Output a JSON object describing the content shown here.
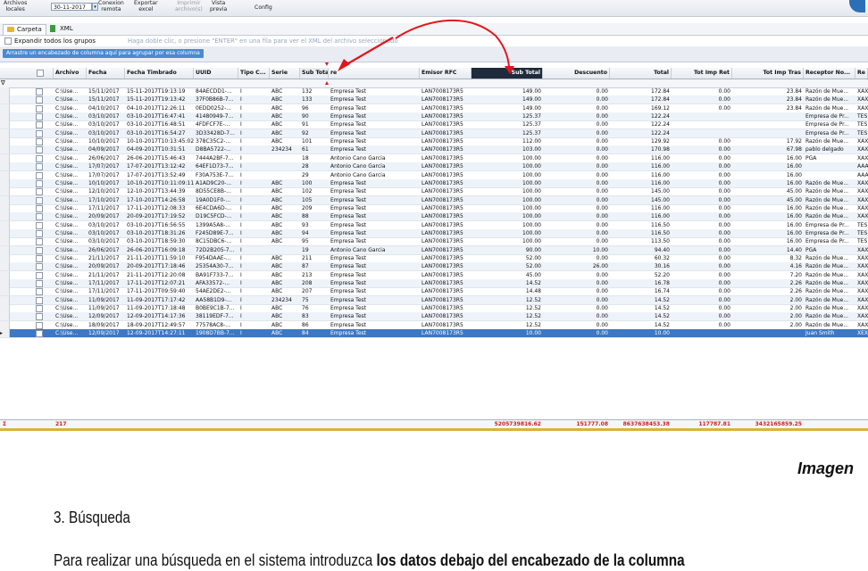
{
  "toolbar": {
    "archivos_line1": "Archivos",
    "archivos_line2": "locales",
    "date_value": "30-11-2017",
    "conexion_line1": "Conexion",
    "conexion_line2": "remota",
    "exportar_line1": "Exportar",
    "exportar_line2": "excel",
    "imprimir_line1": "Imprimir",
    "imprimir_line2": "archivo(s)",
    "vista_line1": "Vista",
    "vista_line2": "previa",
    "config": "Config"
  },
  "tabs": {
    "carpeta": "Carpeta",
    "xml": "XML"
  },
  "expand_label": "Expandir todos los grupos",
  "hint": "Haga doble clic, o presione \"ENTER\" en una fila para ver el XML del archivo seleccionado",
  "group_hint": "Arrastre un encabezado de columna aquí para agrupar por esa columna",
  "columns": [
    "Archivo",
    "Fecha",
    "Fecha Timbrado",
    "UUID",
    "Tipo C...",
    "Serie",
    "Sub Total",
    "re",
    "Emisor RFC",
    "Sub Total",
    "Descuento",
    "Total",
    "Tot Imp Ret",
    "Tot Imp Tras",
    "Receptor No...",
    "Re"
  ],
  "rows": [
    [
      "C:\\Use...",
      "15/11/2017",
      "15-11-2017T19:13:19",
      "84AECDD1-...",
      "I",
      "ABC",
      "132",
      "Empresa Test",
      "LAN7008173R5",
      "149.00",
      "0.00",
      "172.84",
      "0.00",
      "23.84",
      "Razón de Mue...",
      "XAX"
    ],
    [
      "C:\\Use...",
      "15/11/2017",
      "15-11-2017T19:13:42",
      "37F0B86B-7...",
      "I",
      "ABC",
      "133",
      "Empresa Test",
      "LAN7008173R5",
      "149.00",
      "0.00",
      "172.84",
      "0.00",
      "23.84",
      "Razón de Mue...",
      "XAX"
    ],
    [
      "C:\\Use...",
      "04/10/2017",
      "04-10-2017T12:26:11",
      "0EDD0252-...",
      "I",
      "ABC",
      "96",
      "Empresa Test",
      "LAN7008173R5",
      "149.00",
      "0.00",
      "169.12",
      "0.00",
      "23.84",
      "Razón de Mue...",
      "XAX"
    ],
    [
      "C:\\Use...",
      "03/10/2017",
      "03-10-2017T16:47:41",
      "41480949-7...",
      "I",
      "ABC",
      "90",
      "Empresa Test",
      "LAN7008173R5",
      "125.37",
      "0.00",
      "122.24",
      "",
      "",
      "Empresa de Pr...",
      "TES"
    ],
    [
      "C:\\Use...",
      "03/10/2017",
      "03-10-2017T16:48:51",
      "4FDFCF7E-...",
      "I",
      "ABC",
      "91",
      "Empresa Test",
      "LAN7008173R5",
      "125.37",
      "0.00",
      "122.24",
      "",
      "",
      "Empresa de Pr...",
      "TES"
    ],
    [
      "C:\\Use...",
      "03/10/2017",
      "03-10-2017T16:54:27",
      "3D33428D-7...",
      "I",
      "ABC",
      "92",
      "Empresa Test",
      "LAN7008173R5",
      "125.37",
      "0.00",
      "122.24",
      "",
      "",
      "Empresa de Pr...",
      "TES"
    ],
    [
      "C:\\Use...",
      "10/10/2017",
      "10-10-2017T10:13:45:02",
      "378C35C2-...",
      "I",
      "ABC",
      "101",
      "Empresa Test",
      "LAN7008173R5",
      "112.00",
      "0.00",
      "129.92",
      "0.00",
      "17.92",
      "Razón de Mue...",
      "XAX"
    ],
    [
      "C:\\Use...",
      "04/09/2017",
      "04-09-2017T10:31:51",
      "D8BA5722-...",
      "I",
      "234234",
      "61",
      "Empresa Test",
      "LAN7008173R5",
      "103.00",
      "0.00",
      "170.98",
      "0.00",
      "67.98",
      "pablo delgado",
      "XAX"
    ],
    [
      "C:\\Use...",
      "26/06/2017",
      "26-06-2017T15:46:43",
      "7444A2BF-7...",
      "I",
      "",
      "18",
      "Antonio Cano Garcia",
      "LAN7008173R5",
      "100.00",
      "0.00",
      "116.00",
      "0.00",
      "16.00",
      "PGA",
      "XAX"
    ],
    [
      "C:\\Use...",
      "17/07/2017",
      "17-07-2017T13:12:42",
      "64EF1D73-7...",
      "I",
      "",
      "28",
      "Antonio Cano Garcia",
      "LAN7008173R5",
      "100.00",
      "0.00",
      "116.00",
      "0.00",
      "16.00",
      "",
      "AAA"
    ],
    [
      "C:\\Use...",
      "17/07/2017",
      "17-07-2017T13:52:49",
      "F30A753E-7...",
      "I",
      "",
      "29",
      "Antonio Cano Garcia",
      "LAN7008173R5",
      "100.00",
      "0.00",
      "116.00",
      "0.00",
      "16.00",
      "",
      "AAA"
    ],
    [
      "C:\\Use...",
      "10/10/2017",
      "10-10-2017T10:11:09:11",
      "A1AD9C20-...",
      "I",
      "ABC",
      "100",
      "Empresa Test",
      "LAN7008173R5",
      "100.00",
      "0.00",
      "116.00",
      "0.00",
      "16.00",
      "Razón de Mue...",
      "XAX"
    ],
    [
      "C:\\Use...",
      "12/10/2017",
      "12-10-2017T13:44:39",
      "8D55CE8B-...",
      "I",
      "ABC",
      "102",
      "Empresa Test",
      "LAN7008173R5",
      "100.00",
      "0.00",
      "145.00",
      "0.00",
      "45.00",
      "Razón de Mue...",
      "XAX"
    ],
    [
      "C:\\Use...",
      "17/10/2017",
      "17-10-2017T14:26:58",
      "19A0D1F0-...",
      "I",
      "ABC",
      "105",
      "Empresa Test",
      "LAN7008173R5",
      "100.00",
      "0.00",
      "145.00",
      "0.00",
      "45.00",
      "Razón de Mue...",
      "XAX"
    ],
    [
      "C:\\Use...",
      "17/11/2017",
      "17-11-2017T12:08:33",
      "6E4CDA6D-...",
      "I",
      "ABC",
      "209",
      "Empresa Test",
      "LAN7008173R5",
      "100.00",
      "0.00",
      "116.00",
      "0.00",
      "16.00",
      "Razón de Mue...",
      "XAX"
    ],
    [
      "C:\\Use...",
      "20/09/2017",
      "20-09-2017T17:19:52",
      "D19C5FCD-...",
      "I",
      "ABC",
      "88",
      "Empresa Test",
      "LAN7008173R5",
      "100.00",
      "0.00",
      "116.00",
      "0.00",
      "16.00",
      "Razón de Mue...",
      "XAX"
    ],
    [
      "C:\\Use...",
      "03/10/2017",
      "03-10-2017T16:56:55",
      "1399A5A8-...",
      "I",
      "ABC",
      "93",
      "Empresa Test",
      "LAN7008173R5",
      "100.00",
      "0.00",
      "116.50",
      "0.00",
      "16.00",
      "Empresa de Pr...",
      "TES"
    ],
    [
      "C:\\Use...",
      "03/10/2017",
      "03-10-2017T18:31:26",
      "F245D89E-7...",
      "I",
      "ABC",
      "94",
      "Empresa Test",
      "LAN7008173R5",
      "100.00",
      "0.00",
      "116.50",
      "0.00",
      "16.00",
      "Empresa de Pr...",
      "TES"
    ],
    [
      "C:\\Use...",
      "03/10/2017",
      "03-10-2017T18:59:30",
      "8C15DBC6-...",
      "I",
      "ABC",
      "95",
      "Empresa Test",
      "LAN7008173R5",
      "100.00",
      "0.00",
      "113.50",
      "0.00",
      "16.00",
      "Empresa de Pr...",
      "TES"
    ],
    [
      "C:\\Use...",
      "26/06/2017",
      "26-06-2017T16:09:18",
      "72D2B205-7...",
      "I",
      "",
      "19",
      "Antonio Cano Garcia",
      "LAN7008173R5",
      "90.00",
      "10.00",
      "94.40",
      "0.00",
      "14.40",
      "PGA",
      "XAX"
    ],
    [
      "C:\\Use...",
      "21/11/2017",
      "21-11-2017T11:59:10",
      "F954DAAE-...",
      "I",
      "ABC",
      "211",
      "Empresa Test",
      "LAN7008173R5",
      "52.00",
      "0.00",
      "60.32",
      "0.00",
      "8.32",
      "Razón de Mue...",
      "XAX"
    ],
    [
      "C:\\Use...",
      "20/09/2017",
      "20-09-2017T17:18:46",
      "25354A30-7...",
      "I",
      "ABC",
      "87",
      "Empresa Test",
      "LAN7008173R5",
      "52.00",
      "26.00",
      "30.16",
      "0.00",
      "4.16",
      "Razón de Mue...",
      "XAX"
    ],
    [
      "C:\\Use...",
      "21/11/2017",
      "21-11-2017T12:20:08",
      "BA91F733-7...",
      "I",
      "ABC",
      "213",
      "Empresa Test",
      "LAN7008173R5",
      "45.00",
      "0.00",
      "52.20",
      "0.00",
      "7.20",
      "Razón de Mue...",
      "XAX"
    ],
    [
      "C:\\Use...",
      "17/11/2017",
      "17-11-2017T12:07:21",
      "AFA33572-...",
      "I",
      "ABC",
      "208",
      "Empresa Test",
      "LAN7008173R5",
      "14.52",
      "0.00",
      "16.78",
      "0.00",
      "2.26",
      "Razón de Mue...",
      "XAX"
    ],
    [
      "C:\\Use...",
      "17/11/2017",
      "17-11-2017T09:59:40",
      "54AE2DE2-...",
      "I",
      "ABC",
      "207",
      "Empresa Test",
      "LAN7008173R5",
      "14.48",
      "0.00",
      "16.74",
      "0.00",
      "2.26",
      "Razón de Mue...",
      "XAX"
    ],
    [
      "C:\\Use...",
      "11/09/2017",
      "11-09-2017T17:17:42",
      "AA58B1D9-...",
      "I",
      "234234",
      "75",
      "Empresa Test",
      "LAN7008173R5",
      "12.52",
      "0.00",
      "14.52",
      "0.00",
      "2.00",
      "Razón de Mue...",
      "XAX"
    ],
    [
      "C:\\Use...",
      "11/09/2017",
      "11-09-2017T17:18:48",
      "B0BE9C1B-7...",
      "I",
      "ABC",
      "76",
      "Empresa Test",
      "LAN7008173R5",
      "12.52",
      "0.00",
      "14.52",
      "0.00",
      "2.00",
      "Razón de Mue...",
      "XAX"
    ],
    [
      "C:\\Use...",
      "12/09/2017",
      "12-09-2017T14:17:36",
      "38119EDF-7...",
      "I",
      "ABC",
      "83",
      "Empresa Test",
      "LAN7008173R5",
      "12.52",
      "0.00",
      "14.52",
      "0.00",
      "2.00",
      "Razón de Mue...",
      "XAX"
    ],
    [
      "C:\\Use...",
      "18/09/2017",
      "18-09-2017T12:49:57",
      "77578AC8-...",
      "I",
      "ABC",
      "86",
      "Empresa Test",
      "LAN7008173R5",
      "12.52",
      "0.00",
      "14.52",
      "0.00",
      "2.00",
      "Razón de Mue...",
      "XAX"
    ],
    [
      "C:\\Use...",
      "12/09/2017",
      "12-09-2017T14:27:11",
      "1908D7BB-7...",
      "I",
      "ABC",
      "84",
      "Empresa Test",
      "LAN7008173R5",
      "10.00",
      "0.00",
      "10.00",
      "",
      "",
      "Juan Smith",
      "XEX"
    ]
  ],
  "totals": {
    "count": "217",
    "subtotal": "5205739816.62",
    "descuento": "151777.08",
    "total": "8637638453.38",
    "ret": "117787.81",
    "tras": "3432165859.25"
  },
  "doc": {
    "caption": "Imagen",
    "heading": "3.  Búsqueda",
    "paragraph_start": "Para realizar una búsqueda en el sistema introduzca ",
    "paragraph_bold": "los datos debajo del encabezado de la columna"
  },
  "colors": {
    "accent_red": "#e3151b",
    "selected_row": "#3c78c4",
    "header_dark": "#1f2a3b",
    "totals_red": "#d21d1d"
  }
}
